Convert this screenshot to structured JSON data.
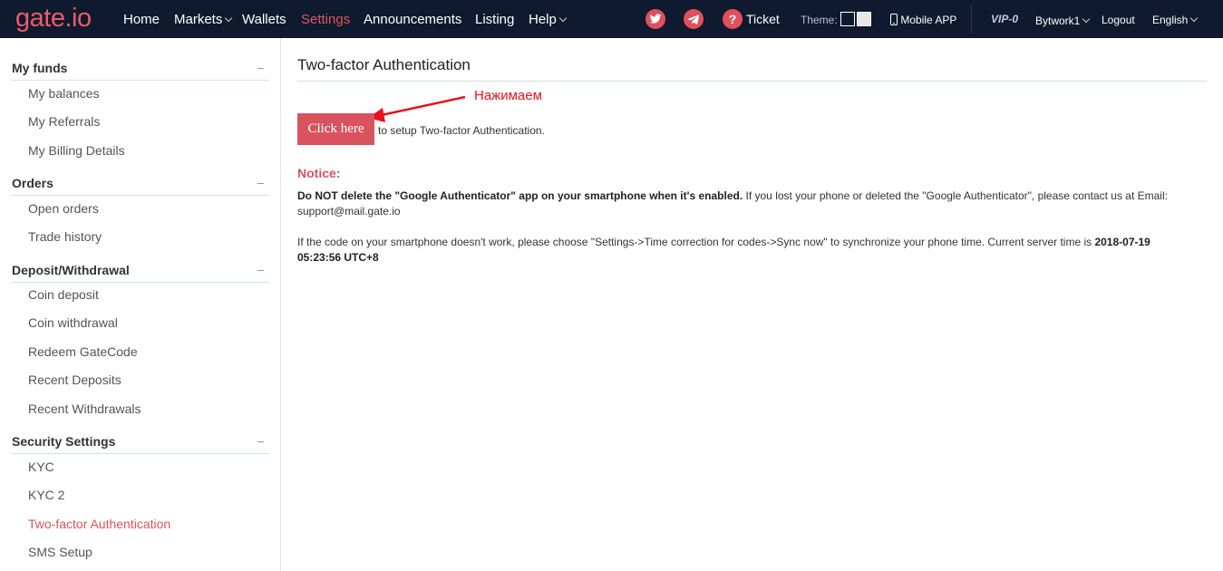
{
  "brand": {
    "logo": "gate.io",
    "accent": "#d9535f",
    "nav_bg": "#0f1a2e"
  },
  "nav": {
    "home": "Home",
    "markets": "Markets",
    "wallets": "Wallets",
    "settings": "Settings",
    "announcements": "Announcements",
    "listing": "Listing",
    "help": "Help",
    "ticket": "Ticket",
    "theme": "Theme:",
    "mobile_app": "Mobile APP",
    "vip": "VIP-0",
    "user": "Bytwork1",
    "logout": "Logout",
    "language": "English",
    "icons": [
      "twitter-icon",
      "telegram-icon",
      "help-circle-icon",
      "mobile-phone-icon"
    ]
  },
  "sidebar": {
    "collapse_symbol": "–",
    "sections": [
      {
        "title": "My funds",
        "items": [
          "My balances",
          "My Referrals",
          "My Billing Details"
        ]
      },
      {
        "title": "Orders",
        "items": [
          "Open orders",
          "Trade history"
        ]
      },
      {
        "title": "Deposit/Withdrawal",
        "items": [
          "Coin deposit",
          "Coin withdrawal",
          "Redeem GateCode",
          "Recent Deposits",
          "Recent Withdrawals"
        ]
      },
      {
        "title": "Security Settings",
        "items": [
          "KYC",
          "KYC 2",
          "Two-factor Authentication",
          "SMS Setup"
        ]
      }
    ],
    "active_item": "Two-factor Authentication"
  },
  "main": {
    "title": "Two-factor Authentication",
    "annotation": "Нажимаем",
    "click_button": "Click here",
    "after_button": "to setup Two-factor Authentication.",
    "notice_title": "Notice:",
    "notice1_bold": "Do NOT delete the \"Google Authenticator\" app on your smartphone when it's enabled.",
    "notice1_rest": " If you lost your phone or deleted the \"Google Authenticator\", please contact us at Email: support@mail.gate.io",
    "notice2_text": "If the code on your smartphone doesn't work, please choose \"Settings->Time correction for codes->Sync now\" to synchronize your phone time. Current server time is ",
    "notice2_time": "2018-07-19 05:23:56 UTC+8"
  }
}
